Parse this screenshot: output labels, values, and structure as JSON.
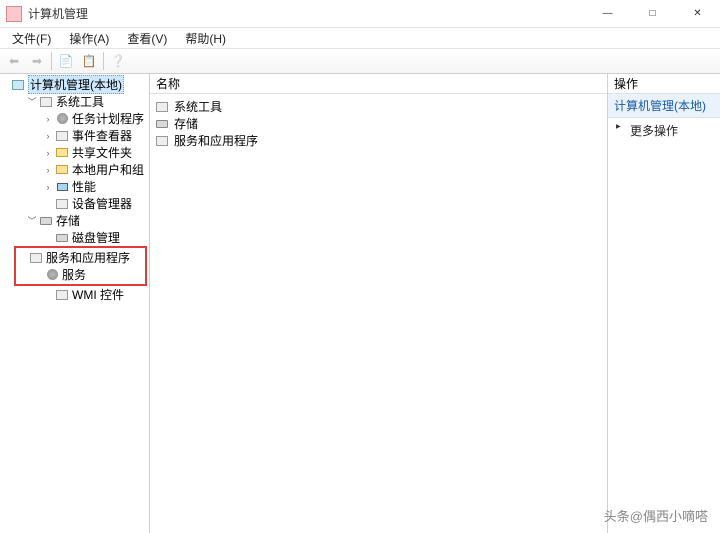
{
  "titlebar": {
    "title": "计算机管理"
  },
  "menubar": {
    "file": "文件(F)",
    "action": "操作(A)",
    "view": "查看(V)",
    "help": "帮助(H)"
  },
  "tree": {
    "root": "计算机管理(本地)",
    "system_tools": "系统工具",
    "task_scheduler": "任务计划程序",
    "event_viewer": "事件查看器",
    "shared_folders": "共享文件夹",
    "local_users": "本地用户和组",
    "performance": "性能",
    "device_manager": "设备管理器",
    "storage": "存储",
    "disk_management": "磁盘管理",
    "services_apps": "服务和应用程序",
    "services": "服务",
    "wmi": "WMI 控件"
  },
  "list": {
    "header_name": "名称",
    "items": {
      "system_tools": "系统工具",
      "storage": "存储",
      "services_apps": "服务和应用程序"
    }
  },
  "actions": {
    "header": "操作",
    "context_title": "计算机管理(本地)",
    "more": "更多操作"
  },
  "watermark": "头条@偶西小嘀嗒"
}
